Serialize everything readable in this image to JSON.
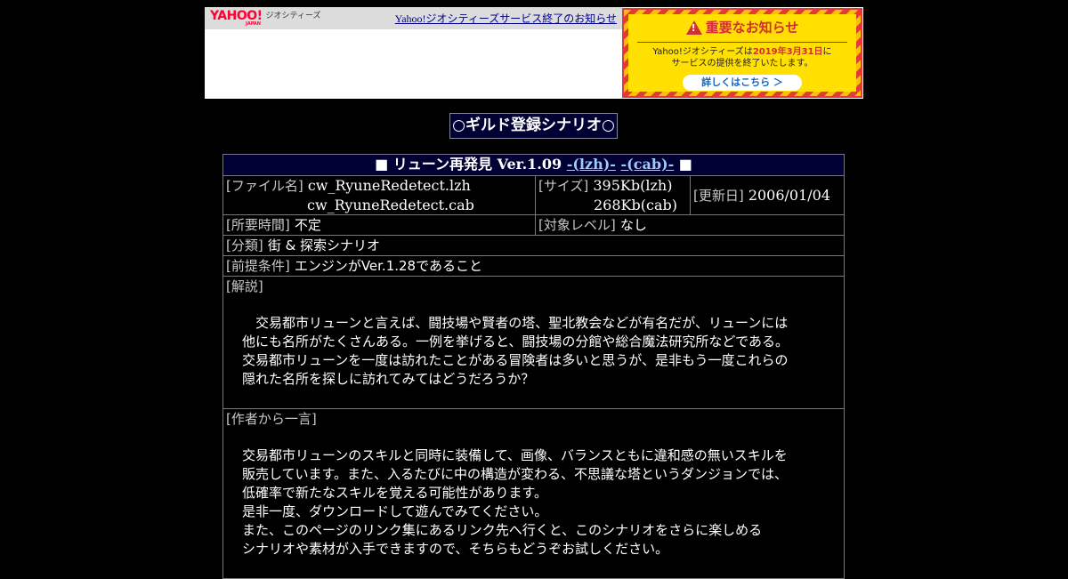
{
  "banner": {
    "logo_text": "YAHOO!",
    "logo_sub": "JAPAN",
    "geo_text": "ジオシティーズ",
    "end_link": "Yahoo!ジオシティーズサービス終了のお知らせ",
    "notice_title": "重要なお知らせ",
    "notice_line1_a": "Yahoo!ジオシティーズは",
    "notice_line1_date": "2019年3月31日",
    "notice_line1_b": "に",
    "notice_line2": "サービスの提供を終了いたします。",
    "notice_button": "詳しくはこちら ＞"
  },
  "page": {
    "title": "○ギルド登録シナリオ○"
  },
  "scenario": {
    "header_prefix": "■ リューン再発見 Ver.1.09 ",
    "link_lzh": "-(lzh)-",
    "link_cab": "-(cab)-",
    "header_suffix": " ■",
    "file_label": "[ファイル名]",
    "file_lzh": "cw_RyuneRedetect.lzh",
    "file_cab": "cw_RyuneRedetect.cab",
    "size_label": "[サイズ]",
    "size_lzh": "395Kb(lzh)",
    "size_cab": "268Kb(cab)",
    "updated_label": "[更新日]",
    "updated_value": "2006/01/04",
    "time_label": "[所要時間]",
    "time_value": "不定",
    "level_label": "[対象レベル]",
    "level_value": "なし",
    "category_label": "[分類]",
    "category_value": "街 & 探索シナリオ",
    "prereq_label": "[前提条件]",
    "prereq_value": "エンジンがVer.1.28であること",
    "desc_label": "[解説]",
    "desc_lines": [
      "　交易都市リューンと言えば、闘技場や賢者の塔、聖北教会などが有名だが、リューンには",
      "他にも名所がたくさんある。一例を挙げると、闘技場の分館や総合魔法研究所などである。",
      "交易都市リューンを一度は訪れたことがある冒険者は多いと思うが、是非もう一度これらの",
      "隠れた名所を探しに訪れてみてはどうだろうか？"
    ],
    "author_label": "[作者から一言]",
    "author_lines": [
      "交易都市リューンのスキルと同時に装備して、画像、バランスともに違和感の無いスキルを",
      "販売しています。また、入るたびに中の構造が変わる、不思議な塔というダンジョンでは、",
      "低確率で新たなスキルを覚える可能性があります。",
      "是非一度、ダウンロードして遊んでみてください。",
      "また、このページのリンク集にあるリンク先へ行くと、このシナリオをさらに楽しめる",
      "シナリオや素材が入手できますので、そちらもどうぞお試しください。"
    ]
  }
}
